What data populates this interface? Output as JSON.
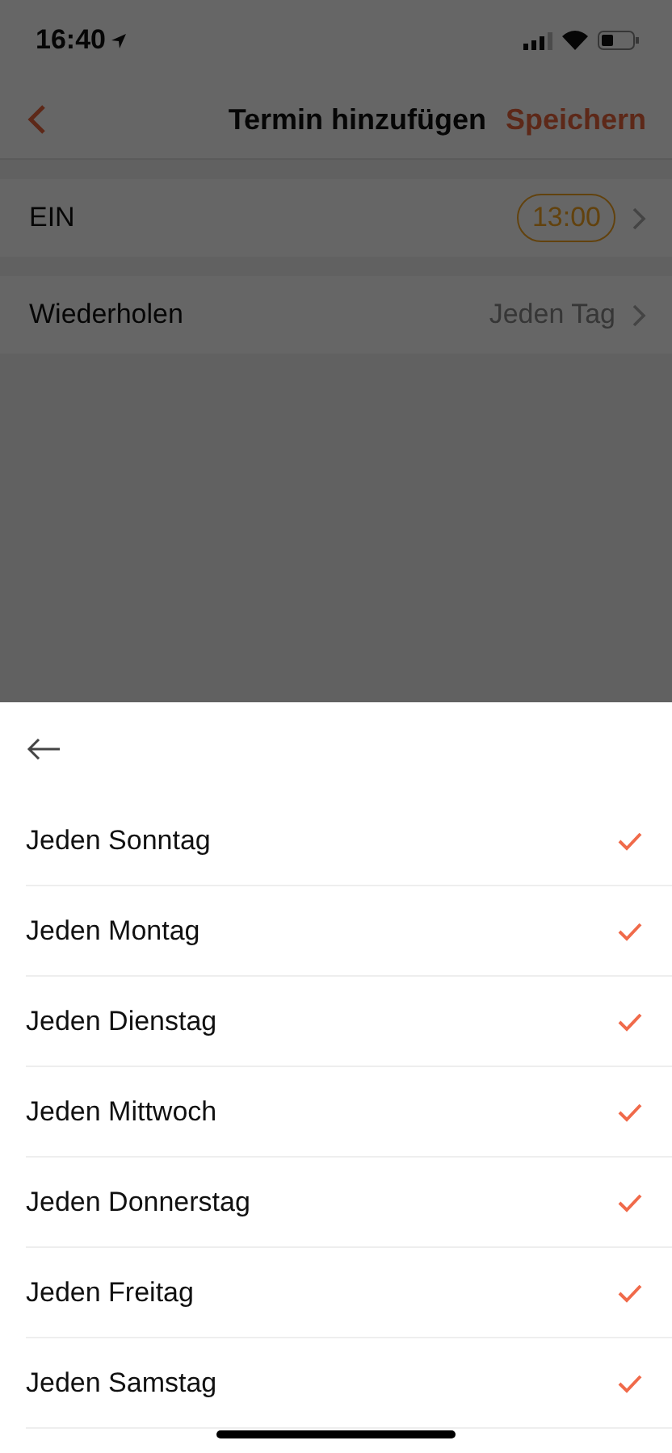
{
  "status_bar": {
    "time": "16:40"
  },
  "nav": {
    "title": "Termin hinzufügen",
    "action": "Speichern"
  },
  "settings": [
    {
      "kind": "time",
      "label": "EIN",
      "value": "13:00"
    },
    {
      "kind": "text",
      "label": "Wiederholen",
      "value": "Jeden Tag"
    }
  ],
  "sheet": {
    "options": [
      {
        "label": "Jeden Sonntag",
        "checked": true
      },
      {
        "label": "Jeden Montag",
        "checked": true
      },
      {
        "label": "Jeden Dienstag",
        "checked": true
      },
      {
        "label": "Jeden Mittwoch",
        "checked": true
      },
      {
        "label": "Jeden Donnerstag",
        "checked": true
      },
      {
        "label": "Jeden Freitag",
        "checked": true
      },
      {
        "label": "Jeden Samstag",
        "checked": true
      }
    ]
  }
}
